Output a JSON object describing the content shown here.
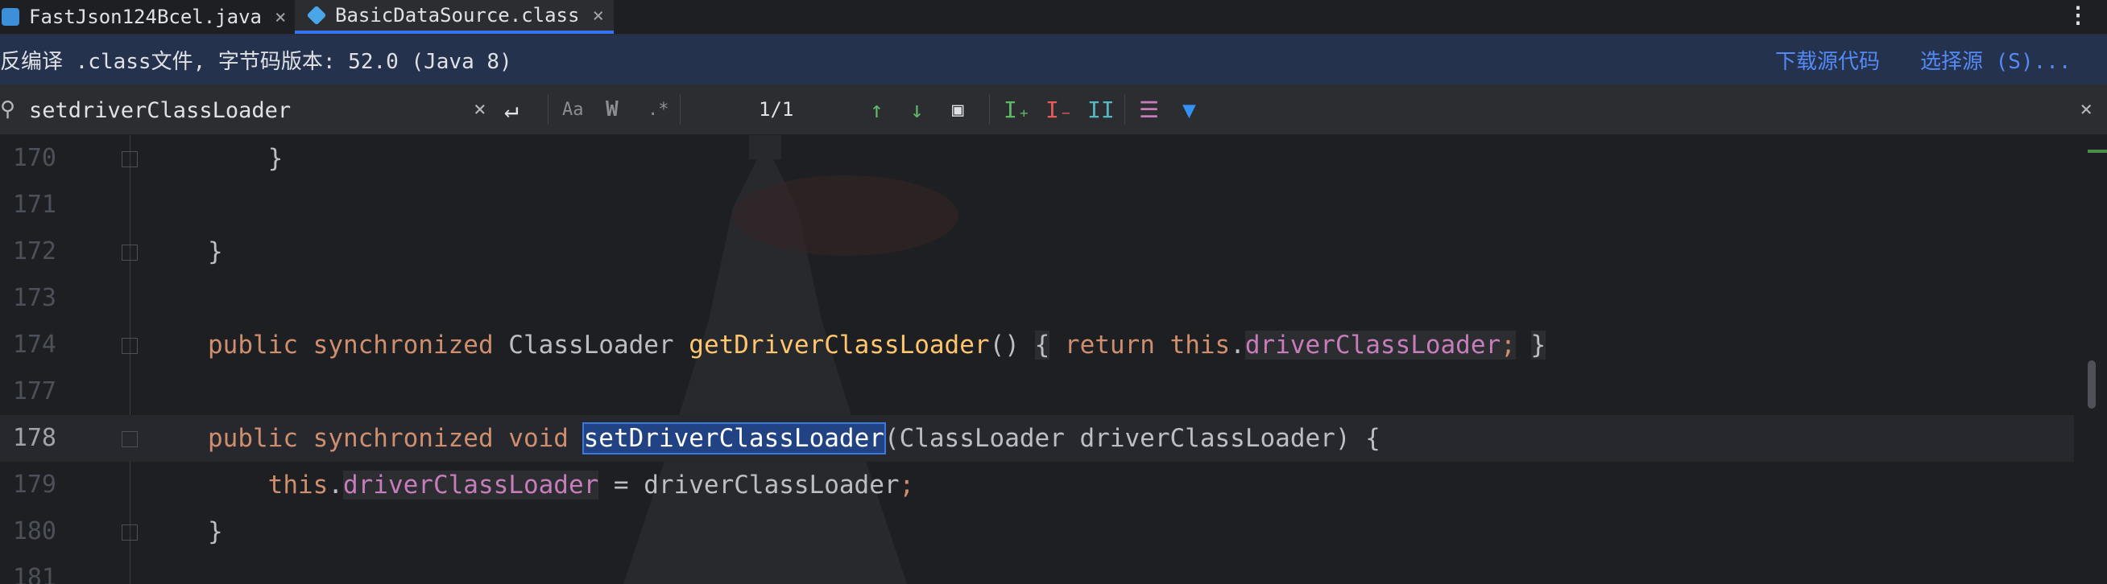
{
  "tabs": [
    {
      "label": "FastJson124Bcel.java",
      "active": false
    },
    {
      "label": "BasicDataSource.class",
      "active": true
    }
  ],
  "info_bar": {
    "message": "反编译 .class文件, 字节码版本: 52.0 (Java 8)",
    "download_link": "下载源代码",
    "choose_source_link": "选择源 (S)..."
  },
  "find_bar": {
    "query": "setdriverClassLoader",
    "match_case_label": "Aa",
    "whole_words_label": "W",
    "regex_label": ".*",
    "result_count": "1/1"
  },
  "colors": {
    "keyword": "#cf8e6d",
    "method": "#ffc66d",
    "field": "#c77dbb",
    "highlight": "#214283",
    "infobar": "#25324d"
  },
  "code_lines": [
    {
      "num": "170",
      "text": "    }"
    },
    {
      "num": "171",
      "text": ""
    },
    {
      "num": "172",
      "text": "}"
    },
    {
      "num": "173",
      "text": ""
    },
    {
      "num": "174",
      "kw1": "public",
      "kw2": "synchronized",
      "type": "ClassLoader",
      "method": "getDriverClassLoader",
      "paren": "() ",
      "brace": "{",
      "kw3": "return",
      "self": "this",
      "field": "driverClassLoader",
      "semi": ";",
      "close": "}"
    },
    {
      "num": "177",
      "text": ""
    },
    {
      "num": "178",
      "kw1": "public",
      "kw2": "synchronized",
      "kw3": "void",
      "method": "setDriverClassLoader",
      "rest": "(ClassLoader driverClassLoader) {"
    },
    {
      "num": "179",
      "self": "this",
      "field": "driverClassLoader",
      "rest": " = driverClassLoader",
      "semi": ";"
    },
    {
      "num": "180",
      "text": "}"
    },
    {
      "num": "181",
      "text": ""
    }
  ]
}
